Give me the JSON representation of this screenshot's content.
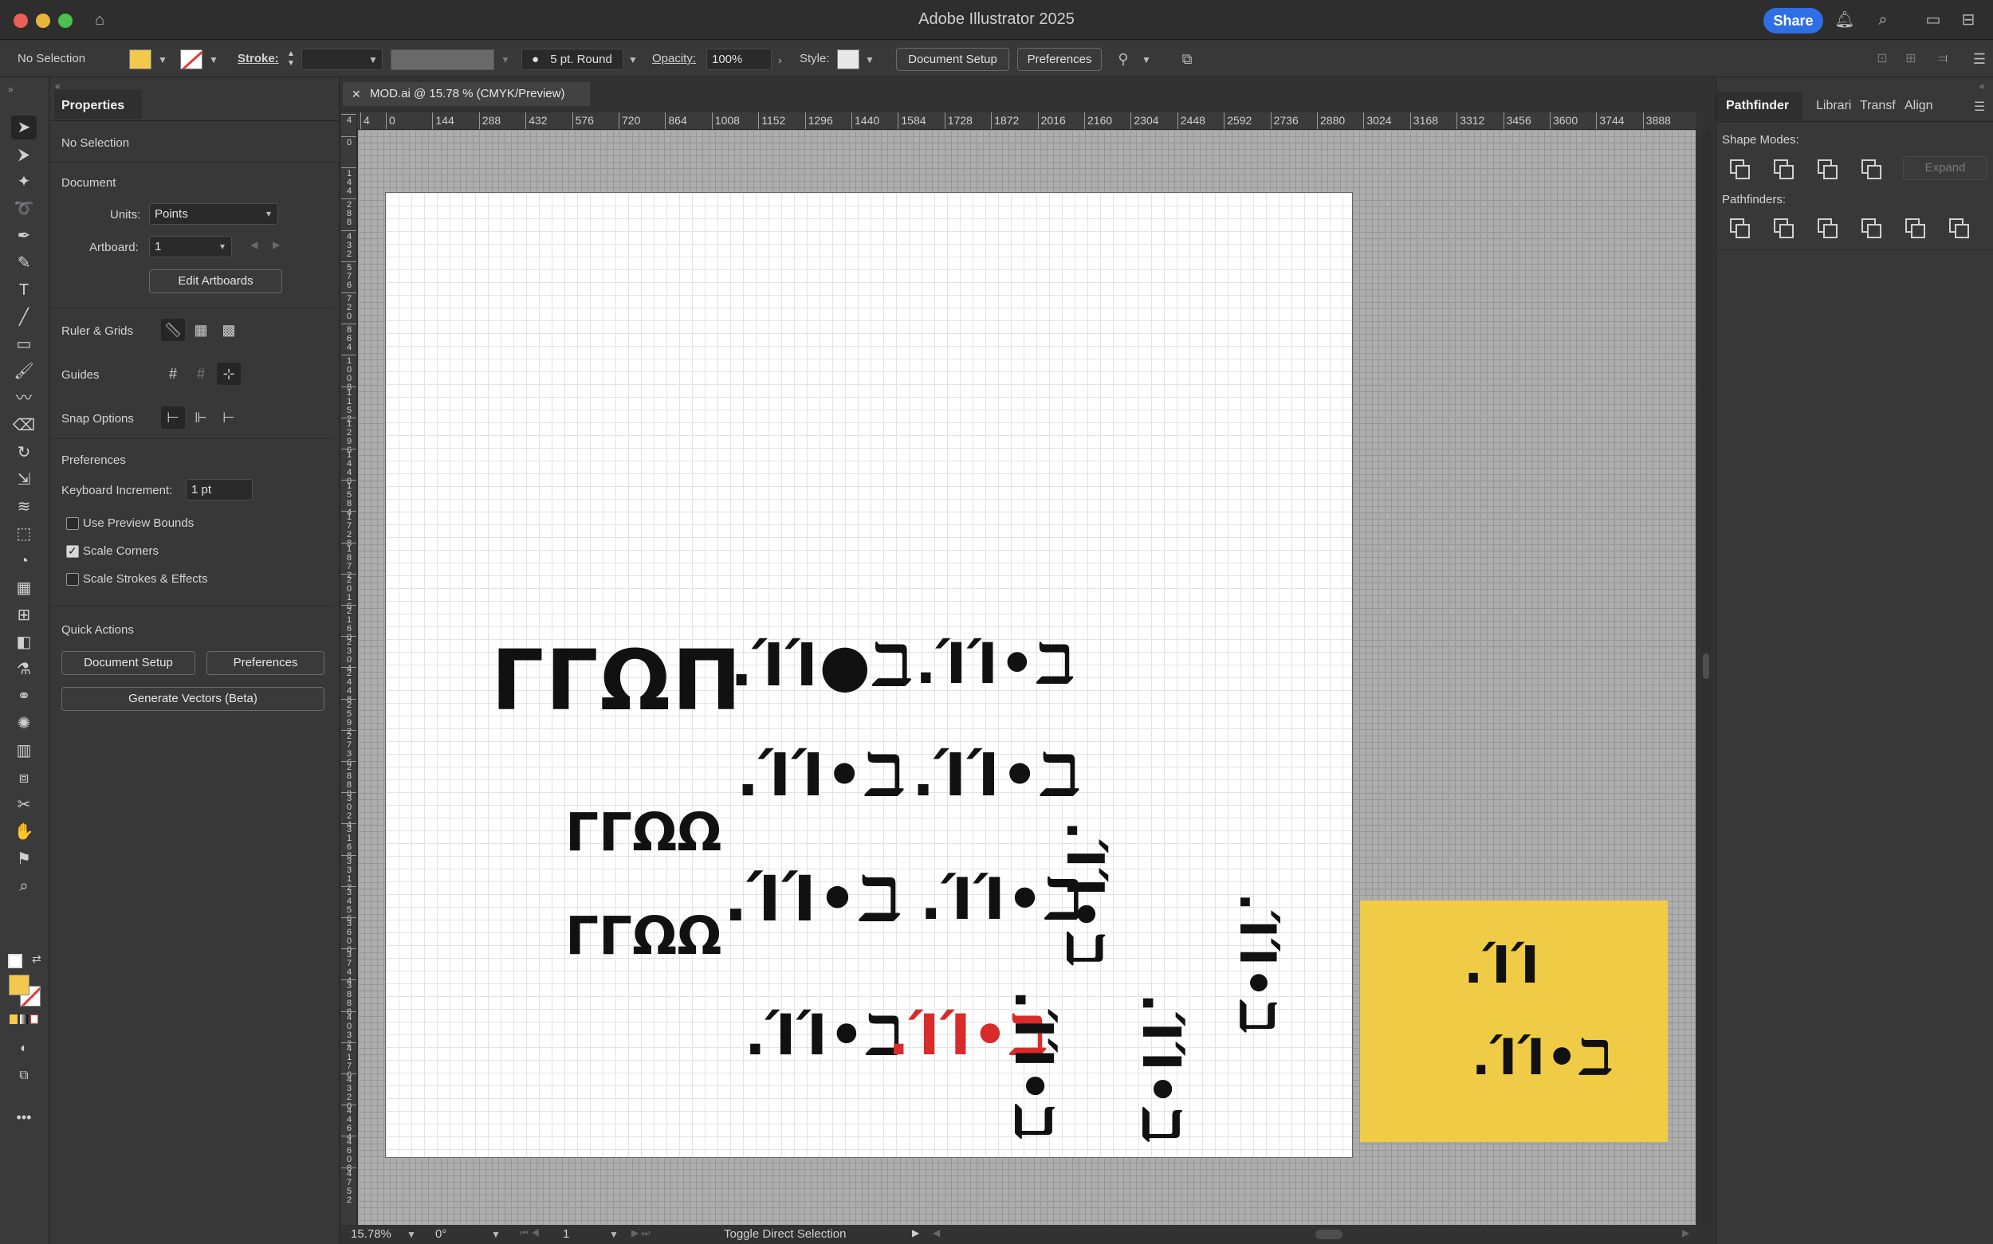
{
  "window": {
    "title": "Adobe Illustrator 2025",
    "share_label": "Share"
  },
  "control_bar": {
    "selection": "No Selection",
    "stroke_label": "Stroke:",
    "brush_value": "5 pt. Round",
    "opacity_label": "Opacity:",
    "opacity_value": "100%",
    "style_label": "Style:",
    "document_setup": "Document Setup",
    "preferences": "Preferences"
  },
  "properties": {
    "tab": "Properties",
    "selection": "No Selection",
    "document_heading": "Document",
    "units_label": "Units:",
    "units_value": "Points",
    "artboard_label": "Artboard:",
    "artboard_value": "1",
    "edit_artboards": "Edit Artboards",
    "ruler_grids": "Ruler & Grids",
    "guides": "Guides",
    "snap_options": "Snap Options",
    "preferences_heading": "Preferences",
    "keyboard_increment_label": "Keyboard Increment:",
    "keyboard_increment_value": "1 pt",
    "use_preview_bounds": "Use Preview Bounds",
    "scale_corners": "Scale Corners",
    "scale_strokes": "Scale Strokes & Effects",
    "checkboxes": {
      "use_preview_bounds": false,
      "scale_corners": true,
      "scale_strokes": false
    },
    "quick_actions": "Quick Actions",
    "qa_document_setup": "Document Setup",
    "qa_preferences": "Preferences",
    "generate_vectors": "Generate Vectors (Beta)"
  },
  "document": {
    "tab_title": "MOD.ai @ 15.78 % (CMYK/Preview)",
    "h_ruler_ticks": [
      "4",
      "0",
      "144",
      "288",
      "432",
      "576",
      "720",
      "864",
      "1008",
      "1152",
      "1296",
      "1440",
      "1584",
      "1728",
      "1872",
      "2016",
      "2160",
      "2304",
      "2448",
      "2592",
      "2736",
      "2880",
      "3024",
      "3168",
      "3312",
      "3456",
      "3600",
      "3744",
      "3888"
    ],
    "v_ruler_ticks": [
      "4",
      "0",
      "144",
      "288",
      "432",
      "576",
      "720",
      "864",
      "1008",
      "1152",
      "1296",
      "1440",
      "1584",
      "1728",
      "1872",
      "2016",
      "2160",
      "2304",
      "2448",
      "2592",
      "2736",
      "2880",
      "3024",
      "3168",
      "3312",
      "3456",
      "3600",
      "3744",
      "3888",
      "4032",
      "4176",
      "4320",
      "4464",
      "4608",
      "4752"
    ],
    "artwork": {
      "mod_wide": "ΓΓΩΠ",
      "mod_small": "ΓΓΩΩ",
      "dots_big": ".ΊΊ●ℶ",
      "dots": ".ΊΊ•ℶ",
      "short": ".ΊΊ"
    },
    "colors": {
      "red_glyph": "#d92b2b",
      "yellow_artboard": "#f0cc46",
      "fill_swatch": "#f2c94c"
    }
  },
  "status": {
    "zoom": "15.78%",
    "rotation": "0°",
    "artboard_nav": "1",
    "message": "Toggle Direct Selection"
  },
  "right_panel": {
    "tabs": [
      "Pathfinder",
      "Librari",
      "Transf",
      "Align"
    ],
    "shape_modes": "Shape Modes:",
    "expand": "Expand",
    "pathfinders": "Pathfinders:"
  }
}
